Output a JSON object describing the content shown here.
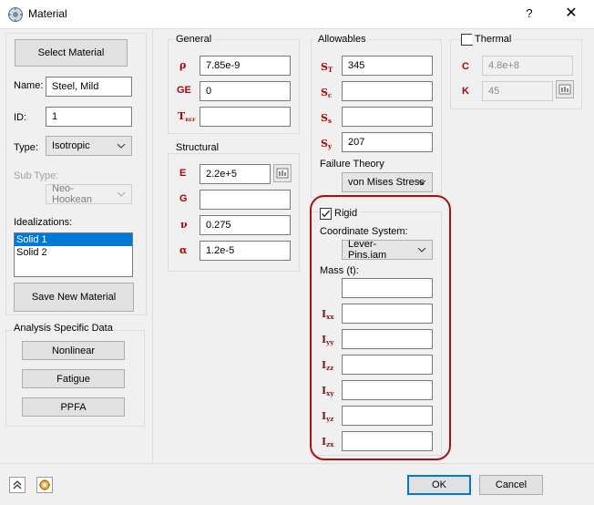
{
  "window": {
    "title": "Material",
    "help": "?",
    "close": "✕"
  },
  "left": {
    "select_material": "Select Material",
    "name_label": "Name:",
    "name_value": "Steel, Mild",
    "id_label": "ID:",
    "id_value": "1",
    "type_label": "Type:",
    "type_value": "Isotropic",
    "subtype_label": "Sub Type:",
    "subtype_value": "Neo-Hookean",
    "idealizations_label": "Idealizations:",
    "idealizations": [
      "Solid 1",
      "Solid 2"
    ],
    "save_new_material": "Save New Material",
    "analysis_group": "Analysis Specific Data",
    "nonlinear": "Nonlinear",
    "fatigue": "Fatigue",
    "ppfa": "PPFA"
  },
  "general": {
    "title": "General",
    "rho_symbol": "ρ",
    "rho_value": "7.85e-9",
    "ge_symbol": "GE",
    "ge_value": "0",
    "tref_symbol": "T",
    "tref_sub": "REF",
    "tref_value": ""
  },
  "structural": {
    "title": "Structural",
    "e_symbol": "E",
    "e_value": "2.2e+5",
    "g_symbol": "G",
    "g_value": "",
    "nu_symbol": "ν",
    "nu_value": "0.275",
    "alpha_symbol": "α",
    "alpha_value": "1.2e-5"
  },
  "allowables": {
    "title": "Allowables",
    "st_symbol": "S",
    "st_sub": "T",
    "st_value": "345",
    "sc_symbol": "S",
    "sc_sub": "c",
    "sc_value": "",
    "ss_symbol": "S",
    "ss_sub": "s",
    "ss_value": "",
    "sy_symbol": "S",
    "sy_sub": "y",
    "sy_value": "207",
    "failure_theory_label": "Failure Theory",
    "failure_theory_value": "von Mises Stress"
  },
  "thermal": {
    "title": "Thermal",
    "checked": false,
    "c_symbol": "C",
    "c_value": "4.8e+8",
    "k_symbol": "K",
    "k_value": "45"
  },
  "rigid": {
    "title": "Rigid",
    "checked": true,
    "coord_label": "Coordinate System:",
    "coord_value": "Lever-Pins.iam",
    "mass_label": "Mass (t):",
    "mass_value": "",
    "inertia": [
      {
        "symbol": "I",
        "sub": "xx",
        "value": ""
      },
      {
        "symbol": "I",
        "sub": "yy",
        "value": ""
      },
      {
        "symbol": "I",
        "sub": "zz",
        "value": ""
      },
      {
        "symbol": "I",
        "sub": "xy",
        "value": ""
      },
      {
        "symbol": "I",
        "sub": "yz",
        "value": ""
      },
      {
        "symbol": "I",
        "sub": "zx",
        "value": ""
      }
    ]
  },
  "footer": {
    "ok": "OK",
    "cancel": "Cancel"
  },
  "colors": {
    "symbol_red": "#b00000",
    "highlight_outline": "#a31515",
    "selection": "#0078d7"
  }
}
